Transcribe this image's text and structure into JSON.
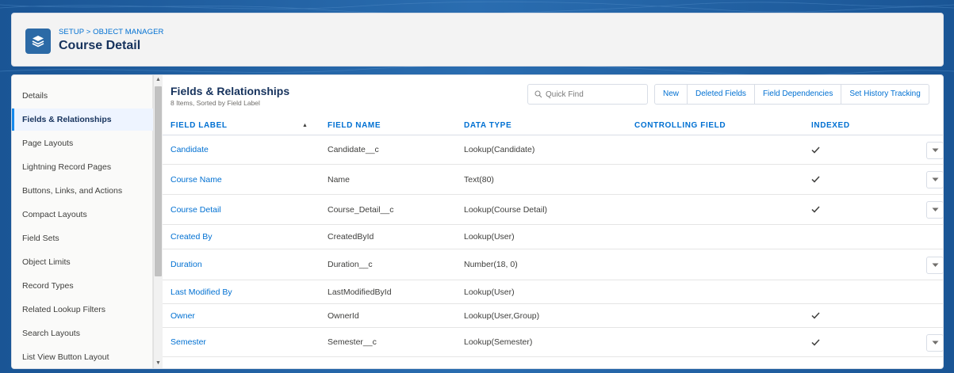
{
  "header": {
    "breadcrumb": "SETUP > OBJECT MANAGER",
    "title": "Course Detail",
    "icon": "layers-icon"
  },
  "sidebar": {
    "items": [
      {
        "label": "Details",
        "active": false
      },
      {
        "label": "Fields & Relationships",
        "active": true
      },
      {
        "label": "Page Layouts",
        "active": false
      },
      {
        "label": "Lightning Record Pages",
        "active": false
      },
      {
        "label": "Buttons, Links, and Actions",
        "active": false
      },
      {
        "label": "Compact Layouts",
        "active": false
      },
      {
        "label": "Field Sets",
        "active": false
      },
      {
        "label": "Object Limits",
        "active": false
      },
      {
        "label": "Record Types",
        "active": false
      },
      {
        "label": "Related Lookup Filters",
        "active": false
      },
      {
        "label": "Search Layouts",
        "active": false
      },
      {
        "label": "List View Button Layout",
        "active": false
      }
    ]
  },
  "section": {
    "title": "Fields & Relationships",
    "subtitle": "8 Items, Sorted by Field Label"
  },
  "search": {
    "placeholder": "Quick Find",
    "value": ""
  },
  "toolbar": {
    "new_label": "New",
    "deleted_fields_label": "Deleted Fields",
    "field_dependencies_label": "Field Dependencies",
    "history_tracking_label": "Set History Tracking"
  },
  "table": {
    "columns": {
      "field_label": "FIELD LABEL",
      "field_name": "FIELD NAME",
      "data_type": "DATA TYPE",
      "controlling_field": "CONTROLLING FIELD",
      "indexed": "INDEXED"
    },
    "rows": [
      {
        "label": "Candidate",
        "name": "Candidate__c",
        "type": "Lookup(Candidate)",
        "controlling": "",
        "indexed": true,
        "menu": true
      },
      {
        "label": "Course Name",
        "name": "Name",
        "type": "Text(80)",
        "controlling": "",
        "indexed": true,
        "menu": true
      },
      {
        "label": "Course Detail",
        "name": "Course_Detail__c",
        "type": "Lookup(Course Detail)",
        "controlling": "",
        "indexed": true,
        "menu": true
      },
      {
        "label": "Created By",
        "name": "CreatedById",
        "type": "Lookup(User)",
        "controlling": "",
        "indexed": false,
        "menu": false
      },
      {
        "label": "Duration",
        "name": "Duration__c",
        "type": "Number(18, 0)",
        "controlling": "",
        "indexed": false,
        "menu": true
      },
      {
        "label": "Last Modified By",
        "name": "LastModifiedById",
        "type": "Lookup(User)",
        "controlling": "",
        "indexed": false,
        "menu": false
      },
      {
        "label": "Owner",
        "name": "OwnerId",
        "type": "Lookup(User,Group)",
        "controlling": "",
        "indexed": true,
        "menu": false
      },
      {
        "label": "Semester",
        "name": "Semester__c",
        "type": "Lookup(Semester)",
        "controlling": "",
        "indexed": true,
        "menu": true
      }
    ]
  },
  "colors": {
    "background": "#1b5a9c",
    "link": "#0070d2",
    "title": "#16325c",
    "active_nav": "#eef4ff"
  }
}
